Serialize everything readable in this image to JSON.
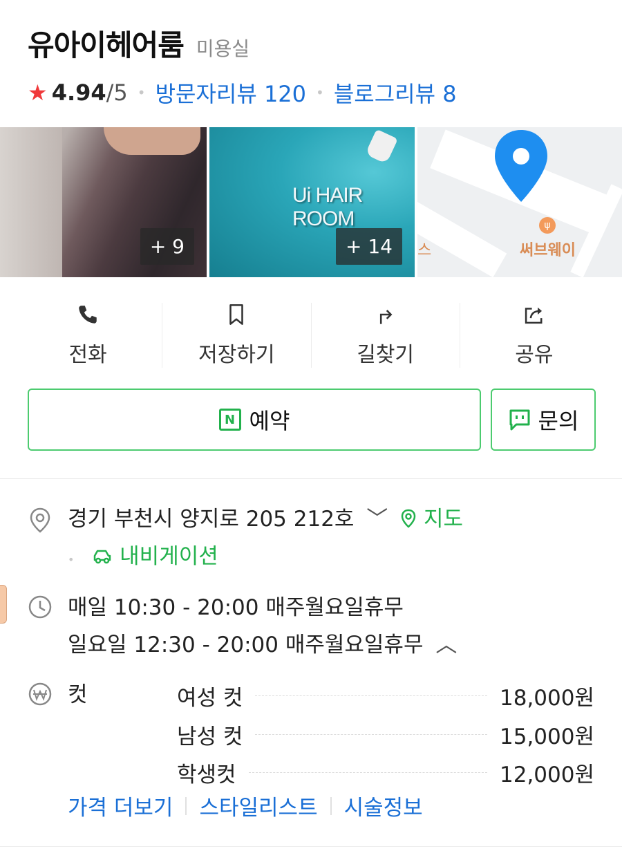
{
  "place": {
    "name": "유아이헤어룸",
    "category": "미용실",
    "rating": "4.94",
    "rating_max": "/5",
    "visitor_reviews": "방문자리뷰 120",
    "blog_reviews": "블로그리뷰 8"
  },
  "photos": [
    {
      "count": "+ 9"
    },
    {
      "count": "+ 14",
      "sign_text": "Ui HAIR ROOM"
    },
    {
      "map_poi": "써브웨이",
      "map_edge_text": "스"
    }
  ],
  "actions": [
    {
      "label": "전화",
      "icon": "phone-icon"
    },
    {
      "label": "저장하기",
      "icon": "bookmark-icon"
    },
    {
      "label": "길찾기",
      "icon": "directions-icon"
    },
    {
      "label": "공유",
      "icon": "share-icon"
    }
  ],
  "buttons": {
    "reserve": "예약",
    "reserve_badge": "N",
    "inquiry": "문의"
  },
  "address": {
    "text": "경기 부천시 양지로 205 212호",
    "map_link": "지도",
    "navigation": "내비게이션"
  },
  "hours": {
    "line1": "매일 10:30 - 20:00 매주월요일휴무",
    "line2": "일요일 12:30 - 20:00 매주월요일휴무"
  },
  "menu": {
    "category": "컷",
    "items": [
      {
        "name": "여성 컷",
        "price": "18,000원"
      },
      {
        "name": "남성 컷",
        "price": "15,000원"
      },
      {
        "name": "학생컷",
        "price": "12,000원"
      }
    ]
  },
  "links": {
    "more_prices": "가격 더보기",
    "stylists": "스타일리스트",
    "treatment_info": "시술정보"
  },
  "colors": {
    "accent_green": "#22b14c",
    "link_blue": "#1a6fd6",
    "star_red": "#f0393b",
    "map_pin_blue": "#1e8ef0"
  }
}
